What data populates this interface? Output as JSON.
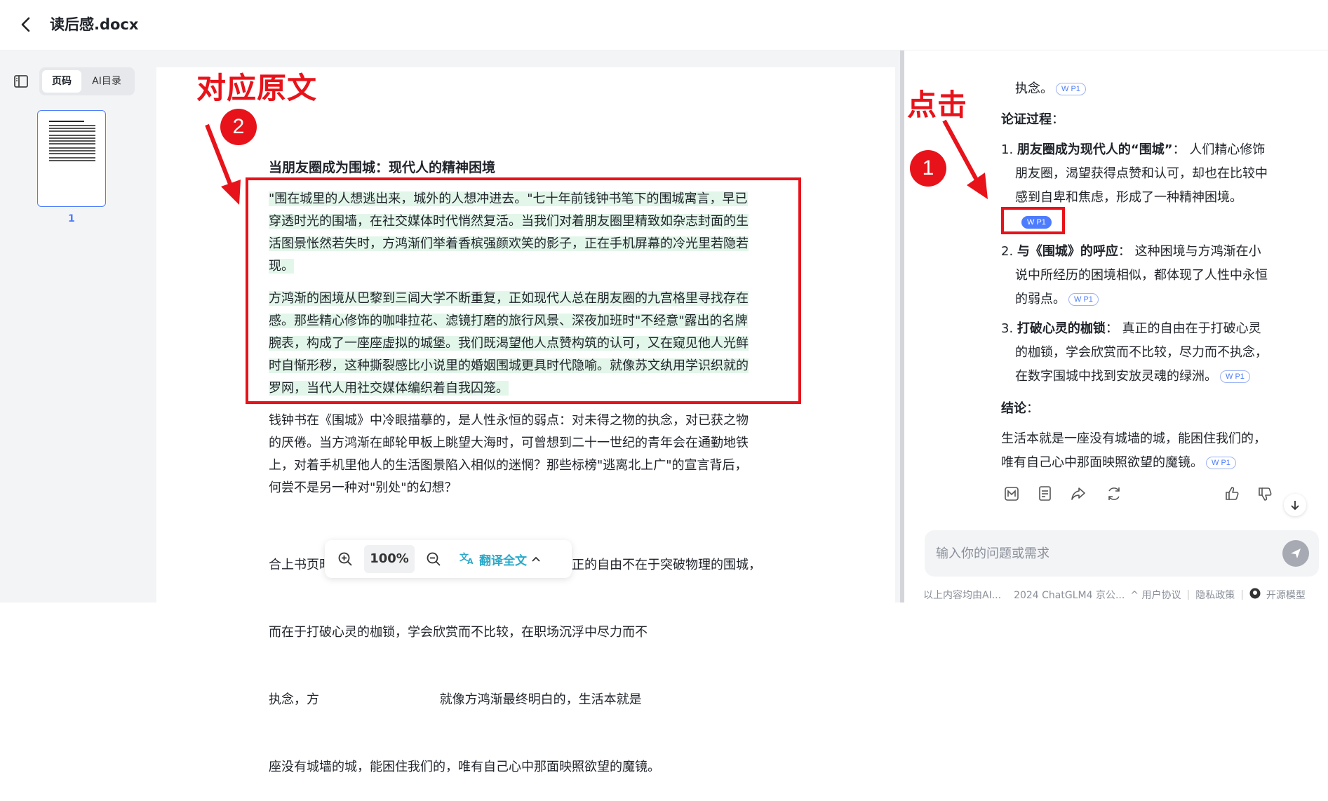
{
  "header": {
    "title": "读后感.docx"
  },
  "sidebar": {
    "tabs": [
      {
        "label": "页码"
      },
      {
        "label": "AI目录"
      }
    ],
    "page_number": "1"
  },
  "annotations": {
    "source_label": "对应原文",
    "click_label": "点击",
    "step_1": "1",
    "step_2": "2",
    "colors": {
      "annotation": "#e8131a",
      "highlight": "#e3f6ea",
      "accent": "#4d7cfe"
    }
  },
  "document": {
    "heading": "当朋友圈成为围城：现代人的精神困境",
    "paragraphs": [
      [
        "\"围在城里的人想逃出来，城外的人想冲进去。\"七十年前钱钟书笔下的围城寓言，早已",
        "穿透时光的围墙，在社交媒体时代悄然复活。当我们对着朋友圈里精致如杂志封面的生",
        "活图景怅然若失时，方鸿渐们举着香槟强颜欢笑的影子，正在手机屏幕的冷光里若隐若",
        "现。"
      ],
      [
        "方鸿渐的困境从巴黎到三闾大学不断重复，正如现代人总在朋友圈的九宫格里寻找存在",
        "感。那些精心修饰的咖啡拉花、滤镜打磨的旅行风景、深夜加班时\"不经意\"露出的名牌",
        "腕表，构成了一座座虚拟的城堡。我们既渴望他人点赞构筑的认可，又在窥见他人光鲜",
        "时自惭形秽，这种撕裂感比小说里的婚姻围城更具时代隐喻。就像苏文纨用学识织就的",
        "罗网，当代人用社交媒体编织着自我囚笼。"
      ],
      [
        "钱钟书在《围城》中冷眼描摹的，是人性永恒的弱点：对未得之物的执念，对已获之物",
        "的厌倦。当方鸿渐在邮轮甲板上眺望大海时，可曾想到二十一世纪的青年会在通勤地铁",
        "上，对着手机里他人的生活图景陷入相似的迷惘？那些标榜\"逃离北上广\"的宣言背后，",
        "何尝不是另一种对\"别处\"的幻想？"
      ],
      [
        "合上书页时，钱钟书的智慧在信息洪流中愈发清晰：真正的自由不在于突破物理的围城，",
        "而在于打破心灵的枷锁，学会欣赏而不比较，在职场沉浮中尽力而不",
        "执念，方                              就像方鸿渐最终明白的，生活本就是",
        "座没有城墙的城，能困住我们的，唯有自己心中那面映照欲望的魔镜。"
      ]
    ]
  },
  "zoom": {
    "value": "100%",
    "translate_label": "翻译全文"
  },
  "chat": {
    "top_fragment": "执念。",
    "cite_label": "W P1",
    "process_title": "论证过程",
    "points": [
      {
        "num": "1.",
        "title": "朋友圈成为现代人的“围城”",
        "lines": [
          "人们精心修饰",
          "朋友圈，渴望获得点赞和认可，却也在比较中",
          "感到自卑和焦虑，形成了一种精神困境。"
        ]
      },
      {
        "num": "2.",
        "title": "与《围城》的呼应",
        "lines": [
          "这种困境与方鸿渐在小",
          "说中所经历的困境相似，都体现了人性中永恒",
          "的弱点。"
        ]
      },
      {
        "num": "3.",
        "title": "打破心灵的枷锁",
        "lines": [
          "真正的自由在于打破心灵",
          "的枷锁，学会欣赏而不比较，尽力而不执念，",
          "在数字围城中找到安放灵魂的绿洲。"
        ]
      }
    ],
    "conclusion_title": "结论",
    "conclusion_lines": [
      "生活本就是一座没有城墙的城，能困住我们的，",
      "唯有自己心中那面映照欲望的魔镜。"
    ],
    "input_placeholder": "输入你的问题或需求",
    "footer": {
      "disclaimer": "以上内容均由AI...",
      "copyright": "2024 ChatGLM4 京公...",
      "user_agreement": "^ 用户协议",
      "privacy": "隐私政策",
      "open_source": "开源模型"
    }
  }
}
